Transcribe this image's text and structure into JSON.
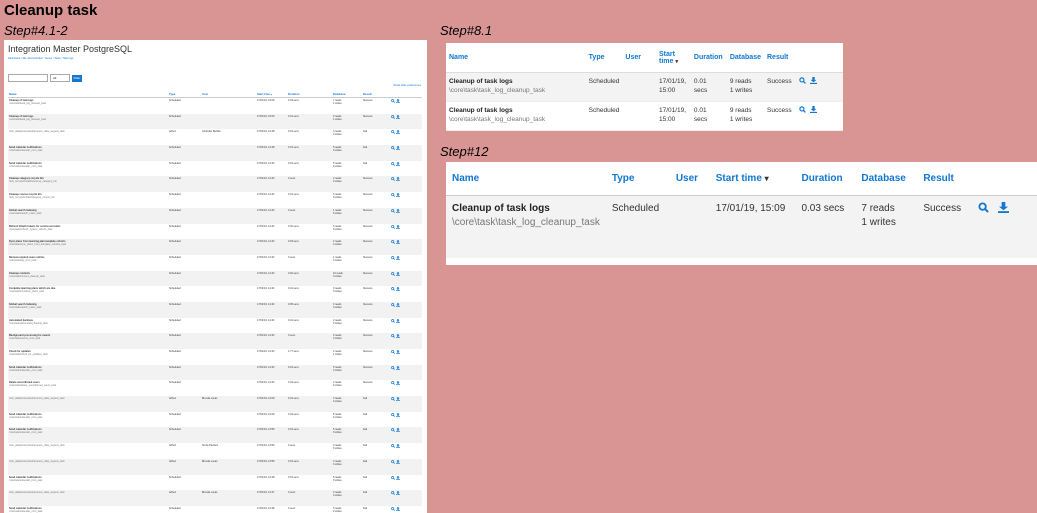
{
  "title": "Cleanup task",
  "steps": {
    "a": "Step#4.1-2",
    "b": "Step#8.1",
    "c": "Step#12"
  },
  "columns": {
    "name": "Name",
    "type": "Type",
    "user": "User",
    "start_time": "Start time",
    "duration": "Duration",
    "database": "Database",
    "result": "Result"
  },
  "panel_a": {
    "site_title": "Integration Master PostgreSQL",
    "breadcrumb": "Dashboard / Site administration / Server / Tasks / Task logs",
    "filter_button": "Filter",
    "filter_select": "All",
    "reset_link": "Reset table preferences",
    "rows": [
      {
        "name": "Cleanup of task logs",
        "cls": "\\core\\task\\task_log_cleanup_task",
        "type": "Scheduled",
        "user": "",
        "start": "17/01/19, 15:09",
        "duration": "0.03 secs",
        "db1": "7 reads",
        "db2": "1 writes",
        "result": "Success"
      },
      {
        "name": "Cleanup of task logs",
        "cls": "\\core\\task\\task_log_cleanup_task",
        "type": "Scheduled",
        "user": "",
        "start": "17/01/19, 15:00",
        "duration": "0.01 secs",
        "db1": "9 reads",
        "db2": "1 writes",
        "result": "Success"
      },
      {
        "name": "",
        "cls": "\\tool_dataprivacy\\task\\process_data_request_task",
        "type": "Adhoc",
        "user": "Charlotte Barbier",
        "start": "17/01/19, 14:48",
        "duration": "0.01 secs",
        "db1": "3 reads",
        "db2": "0 writes",
        "result": "Fail"
      },
      {
        "name": "Send calendar notifications",
        "cls": "\\core\\task\\calendar_cron_task",
        "type": "Scheduled",
        "user": "",
        "start": "17/01/19, 14:48",
        "duration": "0.01 secs",
        "db1": "5 reads",
        "db2": "0 writes",
        "result": "Fail"
      },
      {
        "name": "Send calendar notifications",
        "cls": "\\core\\task\\calendar_cron_task",
        "type": "Scheduled",
        "user": "",
        "start": "17/01/19, 14:32",
        "duration": "0.01 secs",
        "db1": "5 reads",
        "db2": "0 writes",
        "result": "Fail"
      },
      {
        "name": "Cleanup category recycle bin",
        "cls": "\\tool_recyclebin\\task\\cleanup_category_bin",
        "type": "Scheduled",
        "user": "",
        "start": "17/01/19, 14:32",
        "duration": "0 secs",
        "db1": "2 reads",
        "db2": "0 writes",
        "result": "Success"
      },
      {
        "name": "Cleanup course recycle bin",
        "cls": "\\tool_recyclebin\\task\\cleanup_course_bin",
        "type": "Scheduled",
        "user": "",
        "start": "17/01/19, 14:32",
        "duration": "0.01 secs",
        "db1": "3 reads",
        "db2": "0 writes",
        "result": "Success"
      },
      {
        "name": "Global search indexing",
        "cls": "\\core\\task\\search_index_task",
        "type": "Scheduled",
        "user": "",
        "start": "17/01/19, 14:32",
        "duration": "0 secs",
        "db1": "1 reads",
        "db2": "0 writes",
        "result": "Success"
      },
      {
        "name": "Refresh OAuth tokens for service accounts",
        "cls": "\\core\\task\\refresh_system_tokens_task",
        "type": "Scheduled",
        "user": "",
        "start": "17/01/19, 14:32",
        "duration": "0.02 secs",
        "db1": "3 reads",
        "db2": "0 writes",
        "result": "Success"
      },
      {
        "name": "Sync plans from learning plan template cohorts",
        "cls": "\\core\\task\\sync_plans_from_template_cohorts_task",
        "type": "Scheduled",
        "user": "",
        "start": "17/01/19, 14:32",
        "duration": "0.03 secs",
        "db1": "4 reads",
        "db2": "0 writes",
        "result": "Success"
      },
      {
        "name": "Remove expired users entries",
        "cls": "\\core\\task\\tag_cron_task",
        "type": "Scheduled",
        "user": "",
        "start": "17/01/19, 14:32",
        "duration": "0 secs",
        "db1": "1 reads",
        "db2": "0 writes",
        "result": "Success"
      },
      {
        "name": "Cleanup contexts",
        "cls": "\\core\\task\\context_cleanup_task",
        "type": "Scheduled",
        "user": "",
        "start": "17/01/19, 14:32",
        "duration": "0.02 secs",
        "db1": "10 reads",
        "db2": "0 writes",
        "result": "Success"
      },
      {
        "name": "Complete learning plans which are due",
        "cls": "\\core\\task\\complete_plans_task",
        "type": "Scheduled",
        "user": "",
        "start": "17/01/19, 14:32",
        "duration": "0.01 secs",
        "db1": "3 reads",
        "db2": "0 writes",
        "result": "Success"
      },
      {
        "name": "Global search indexing",
        "cls": "\\core\\task\\search_index_task",
        "type": "Scheduled",
        "user": "",
        "start": "17/01/19, 14:32",
        "duration": "0.05 secs",
        "db1": "4 reads",
        "db2": "0 writes",
        "result": "Success"
      },
      {
        "name": "Automated backups",
        "cls": "\\core\\task\\automated_backup_task",
        "type": "Scheduled",
        "user": "",
        "start": "17/01/19, 14:32",
        "duration": "0.01 secs",
        "db1": "2 reads",
        "db2": "0 writes",
        "result": "Success"
      },
      {
        "name": "Background processing for events",
        "cls": "\\core\\task\\events_cron_task",
        "type": "Scheduled",
        "user": "",
        "start": "17/01/19, 14:32",
        "duration": "0 secs",
        "db1": "0 reads",
        "db2": "0 writes",
        "result": "Success"
      },
      {
        "name": "Check for updates",
        "cls": "\\core\\task\\check_for_updates_task",
        "type": "Scheduled",
        "user": "",
        "start": "17/01/19, 14:32",
        "duration": "1.77 secs",
        "db1": "4 reads",
        "db2": "1 writes",
        "result": "Success"
      },
      {
        "name": "Send calendar notifications",
        "cls": "\\core\\task\\calendar_cron_task",
        "type": "Scheduled",
        "user": "",
        "start": "17/01/19, 14:32",
        "duration": "0.01 secs",
        "db1": "5 reads",
        "db2": "0 writes",
        "result": "Success"
      },
      {
        "name": "Delete unconfirmed users",
        "cls": "\\core\\task\\delete_unconfirmed_users_task",
        "type": "Scheduled",
        "user": "",
        "start": "17/01/19, 14:32",
        "duration": "0.01 secs",
        "db1": "2 reads",
        "db2": "0 writes",
        "result": "Success"
      },
      {
        "name": "",
        "cls": "\\tool_dataprivacy\\task\\process_data_request_task",
        "type": "Adhoc",
        "user": "Brenda Lucas",
        "start": "17/01/19, 14:09",
        "duration": "0.01 secs",
        "db1": "3 reads",
        "db2": "0 writes",
        "result": "Fail"
      },
      {
        "name": "Send calendar notifications",
        "cls": "\\core\\task\\calendar_cron_task",
        "type": "Scheduled",
        "user": "",
        "start": "17/01/19, 14:09",
        "duration": "0.01 secs",
        "db1": "5 reads",
        "db2": "0 writes",
        "result": "Fail"
      },
      {
        "name": "Send calendar notifications",
        "cls": "\\core\\task\\calendar_cron_task",
        "type": "Scheduled",
        "user": "",
        "start": "17/01/19, 13:59",
        "duration": "0.01 secs",
        "db1": "5 reads",
        "db2": "0 writes",
        "result": "Fail"
      },
      {
        "name": "",
        "cls": "\\tool_dataprivacy\\task\\process_data_request_task",
        "type": "Adhoc",
        "user": "Sonia Paxiano",
        "start": "17/01/19, 13:59",
        "duration": "0 secs",
        "db1": "3 reads",
        "db2": "0 writes",
        "result": "Fail"
      },
      {
        "name": "",
        "cls": "\\tool_dataprivacy\\task\\process_data_request_task",
        "type": "Adhoc",
        "user": "Brenda Lucas",
        "start": "17/01/19, 13:59",
        "duration": "0.01 secs",
        "db1": "3 reads",
        "db2": "0 writes",
        "result": "Fail"
      },
      {
        "name": "Send calendar notifications",
        "cls": "\\core\\task\\calendar_cron_task",
        "type": "Scheduled",
        "user": "",
        "start": "17/01/19, 13:48",
        "duration": "0.01 secs",
        "db1": "5 reads",
        "db2": "0 writes",
        "result": "Fail"
      },
      {
        "name": "",
        "cls": "\\tool_dataprivacy\\task\\process_data_request_task",
        "type": "Adhoc",
        "user": "Brenda Lucas",
        "start": "17/01/19, 13:47",
        "duration": "0 secs",
        "db1": "3 reads",
        "db2": "0 writes",
        "result": "Fail"
      },
      {
        "name": "Send calendar notifications",
        "cls": "\\core\\task\\calendar_cron_task",
        "type": "Scheduled",
        "user": "",
        "start": "17/01/19, 13:48",
        "duration": "0 secs",
        "db1": "5 reads",
        "db2": "0 writes",
        "result": "Fail"
      }
    ]
  },
  "panel_b": {
    "rows": [
      {
        "name": "Cleanup of task logs",
        "cls": "\\core\\task\\task_log_cleanup_task",
        "type": "Scheduled",
        "user": "",
        "start1": "17/01/19,",
        "start2": "15:00",
        "dur1": "0.01",
        "dur2": "secs",
        "db1": "9 reads",
        "db2": "1 writes",
        "result": "Success"
      },
      {
        "name": "Cleanup of task logs",
        "cls": "\\core\\task\\task_log_cleanup_task",
        "type": "Scheduled",
        "user": "",
        "start1": "17/01/19,",
        "start2": "15:00",
        "dur1": "0.01",
        "dur2": "secs",
        "db1": "9 reads",
        "db2": "1 writes",
        "result": "Success"
      }
    ]
  },
  "panel_c": {
    "row": {
      "name": "Cleanup of task logs",
      "cls": "\\core\\task\\task_log_cleanup_task",
      "type": "Scheduled",
      "user": "",
      "start": "17/01/19, 15:09",
      "duration": "0.03 secs",
      "db1": "7 reads",
      "db2": "1 writes",
      "result": "Success"
    }
  },
  "icons": {
    "view": "search-icon",
    "download": "download-icon"
  },
  "colors": {
    "background": "#d99594",
    "link": "#1177d1"
  }
}
